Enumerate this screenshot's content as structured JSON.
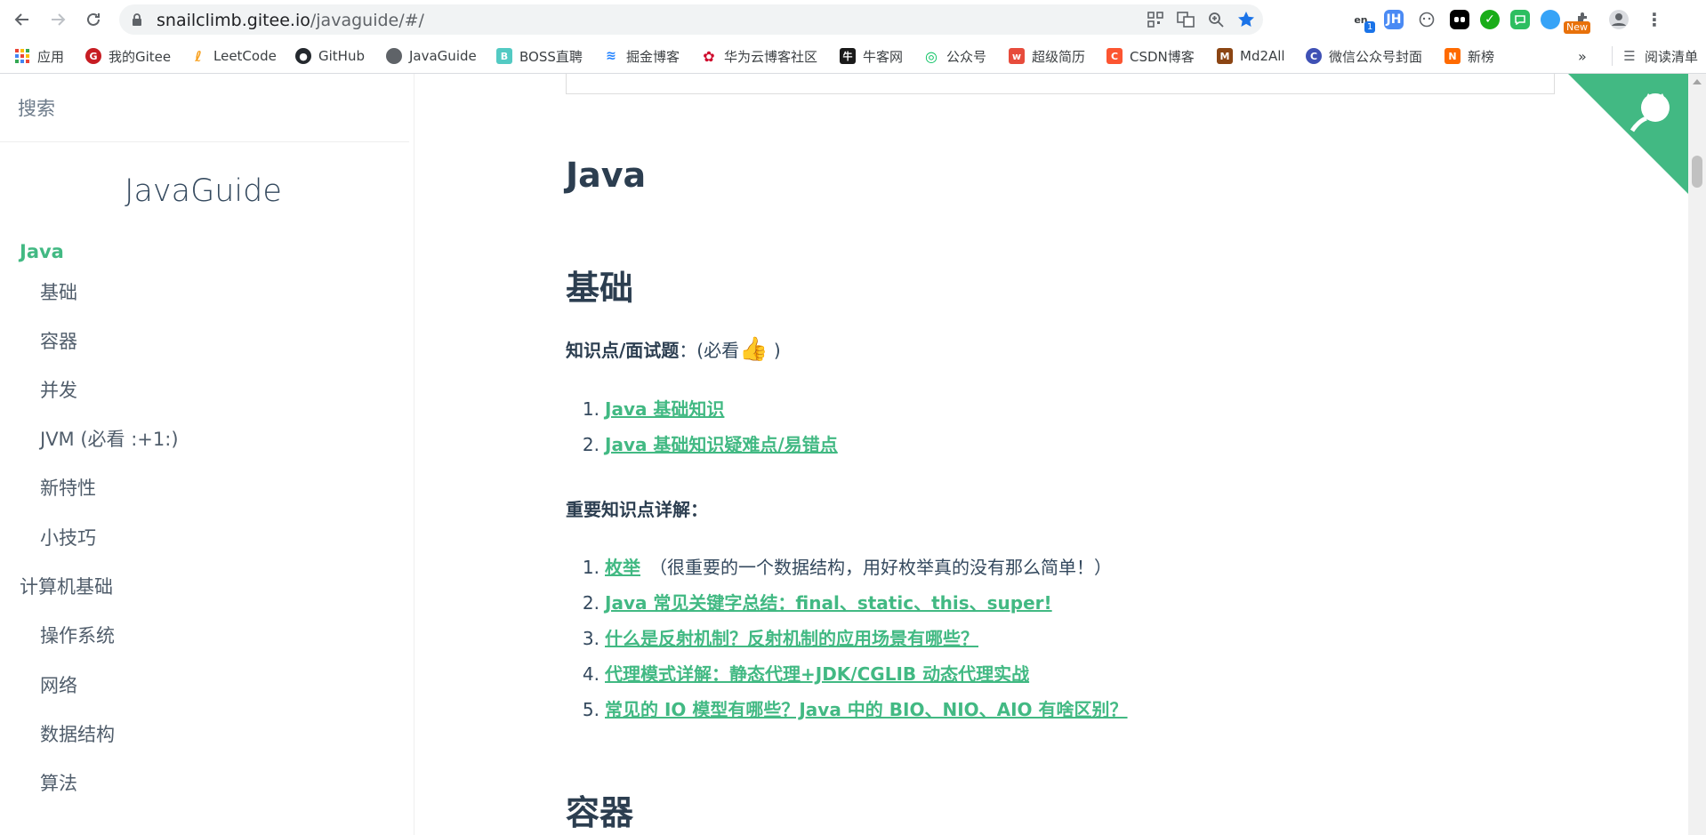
{
  "browser": {
    "url_host": "snailclimb.gitee.io",
    "url_path": "/javaguide/#/",
    "colors": {
      "accent": "#42b983",
      "star": "#1a73e8"
    },
    "extensions": {
      "translate_badge": "1",
      "jh_label": "JH",
      "new_badge": "New"
    }
  },
  "bookmarks": [
    {
      "label": "应用",
      "icon": "apps-grid-icon"
    },
    {
      "label": "我的Gitee",
      "icon": "gitee-icon"
    },
    {
      "label": "LeetCode",
      "icon": "leetcode-icon"
    },
    {
      "label": "GitHub",
      "icon": "github-icon"
    },
    {
      "label": "JavaGuide",
      "icon": "globe-icon"
    },
    {
      "label": "BOSS直聘",
      "icon": "boss-icon"
    },
    {
      "label": "掘金博客",
      "icon": "juejin-icon"
    },
    {
      "label": "华为云博客社区",
      "icon": "huawei-icon"
    },
    {
      "label": "牛客网",
      "icon": "nowcoder-icon"
    },
    {
      "label": "公众号",
      "icon": "wechat-mp-icon"
    },
    {
      "label": "超级简历",
      "icon": "resume-icon"
    },
    {
      "label": "CSDN博客",
      "icon": "csdn-icon"
    },
    {
      "label": "Md2All",
      "icon": "md2all-icon"
    },
    {
      "label": "微信公众号封面",
      "icon": "cover-icon"
    },
    {
      "label": "新榜",
      "icon": "xinbang-icon"
    },
    {
      "label": "»",
      "icon": "more-icon"
    },
    {
      "label": "阅读清单",
      "icon": "reading-list-icon"
    }
  ],
  "sidebar": {
    "search_placeholder": "搜索",
    "app_name": "JavaGuide",
    "items": [
      {
        "label": "Java",
        "level": "top",
        "active": true
      },
      {
        "label": "基础",
        "level": "sub"
      },
      {
        "label": "容器",
        "level": "sub"
      },
      {
        "label": "并发",
        "level": "sub"
      },
      {
        "label": "JVM (必看 :+1:)",
        "level": "sub"
      },
      {
        "label": "新特性",
        "level": "sub"
      },
      {
        "label": "小技巧",
        "level": "sub"
      },
      {
        "label": "计算机基础",
        "level": "top"
      },
      {
        "label": "操作系统",
        "level": "sub"
      },
      {
        "label": "网络",
        "level": "sub"
      },
      {
        "label": "数据结构",
        "level": "sub"
      },
      {
        "label": "算法",
        "level": "sub"
      }
    ]
  },
  "content": {
    "h1": "Java",
    "section1_title": "基础",
    "knowledge_label": "知识点/面试题",
    "knowledge_suffix": "：(必看",
    "thumbs": "👍",
    "close_paren": " )",
    "basics_list": [
      {
        "num": "1.",
        "label": "Java 基础知识"
      },
      {
        "num": "2.",
        "label": "Java 基础知识疑难点/易错点"
      }
    ],
    "important_label": "重要知识点详解：",
    "important_list": [
      {
        "num": "1.",
        "label": "枚举",
        "note": "（很重要的一个数据结构，用好枚举真的没有那么简单！）"
      },
      {
        "num": "2.",
        "label": "Java 常见关键字总结：final、static、this、super!"
      },
      {
        "num": "3.",
        "label": "什么是反射机制？反射机制的应用场景有哪些？"
      },
      {
        "num": "4.",
        "label": "代理模式详解：静态代理+JDK/CGLIB 动态代理实战"
      },
      {
        "num": "5.",
        "label": "常见的 IO 模型有哪些？Java 中的 BIO、NIO、AIO 有啥区别？"
      }
    ],
    "section2_title": "容器"
  }
}
